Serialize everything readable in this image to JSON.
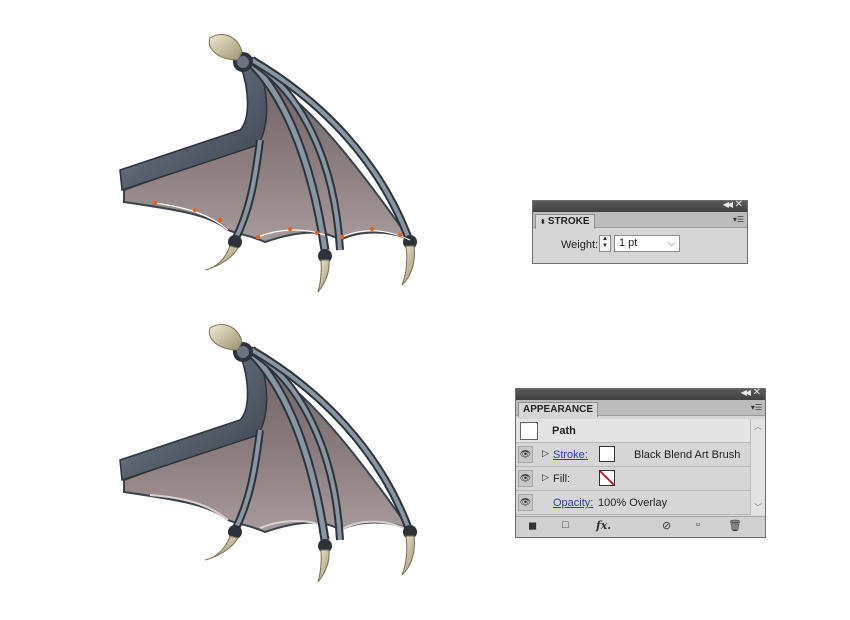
{
  "stroke_panel": {
    "tab": "STROKE",
    "weight_label": "Weight:",
    "weight_value": "1 pt"
  },
  "appearance_panel": {
    "tab": "APPEARANCE",
    "object": "Path",
    "stroke_label": "Stroke:",
    "stroke_value": "Black Blend Art Brush",
    "fill_label": "Fill:",
    "opacity_label": "Opacity:",
    "opacity_value": "100% Overlay"
  },
  "colors": {
    "membrane": "#8a7a7a",
    "bone": "#4a5563",
    "claw": "#c9c2a0",
    "anchor": "#e8641a"
  },
  "icons": [
    "wing-illustration",
    "collapse-icon",
    "close-icon",
    "panel-menu-icon",
    "eye-icon",
    "fx-icon",
    "clear-icon",
    "duplicate-icon",
    "trash-icon"
  ]
}
